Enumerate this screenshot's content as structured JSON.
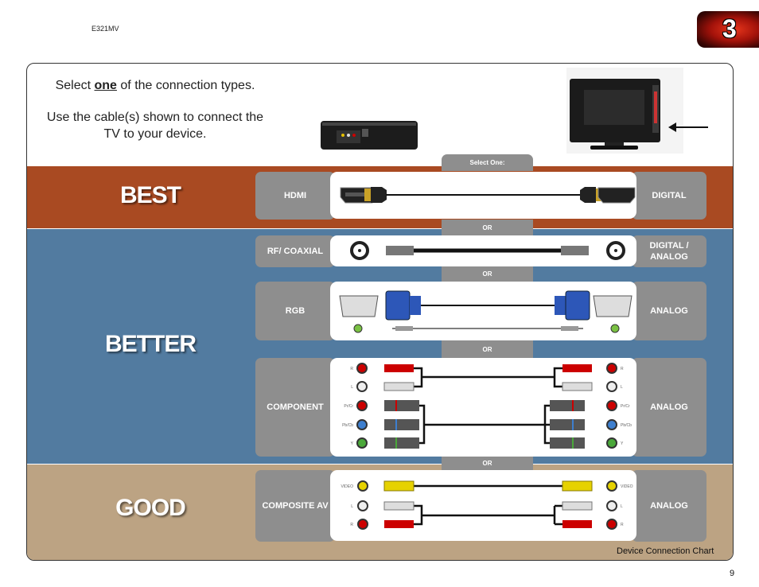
{
  "header": {
    "model": "E321MV",
    "chapter": "3"
  },
  "intro": {
    "line1_pre": "Select ",
    "line1_em": "one",
    "line1_post": " of the connection types.",
    "line2": "Use the cable(s) shown to connect the TV to your device."
  },
  "bands": {
    "best": "BEST",
    "better": "BETTER",
    "good": "GOOD"
  },
  "select_one": "Select One:",
  "or": "OR",
  "rows": [
    {
      "name": "HDMI",
      "type": "DIGITAL"
    },
    {
      "name": "RF/ COAXIAL",
      "type": "DIGITAL / ANALOG"
    },
    {
      "name": "RGB",
      "type": "ANALOG"
    },
    {
      "name": "COMPONENT",
      "type": "ANALOG"
    },
    {
      "name": "COMPOSITE AV",
      "type": "ANALOG"
    }
  ],
  "component_jacks": [
    "R",
    "L",
    "Pr/Cr",
    "Pb/Cb",
    "Y"
  ],
  "composite_jacks": [
    "VIDEO",
    "L",
    "R"
  ],
  "colors": {
    "best": "#a94a22",
    "better": "#527ba0",
    "good": "#bca383",
    "label_gray": "#8e8e8e"
  },
  "footer": {
    "caption": "Device Connection Chart",
    "page": "9"
  }
}
